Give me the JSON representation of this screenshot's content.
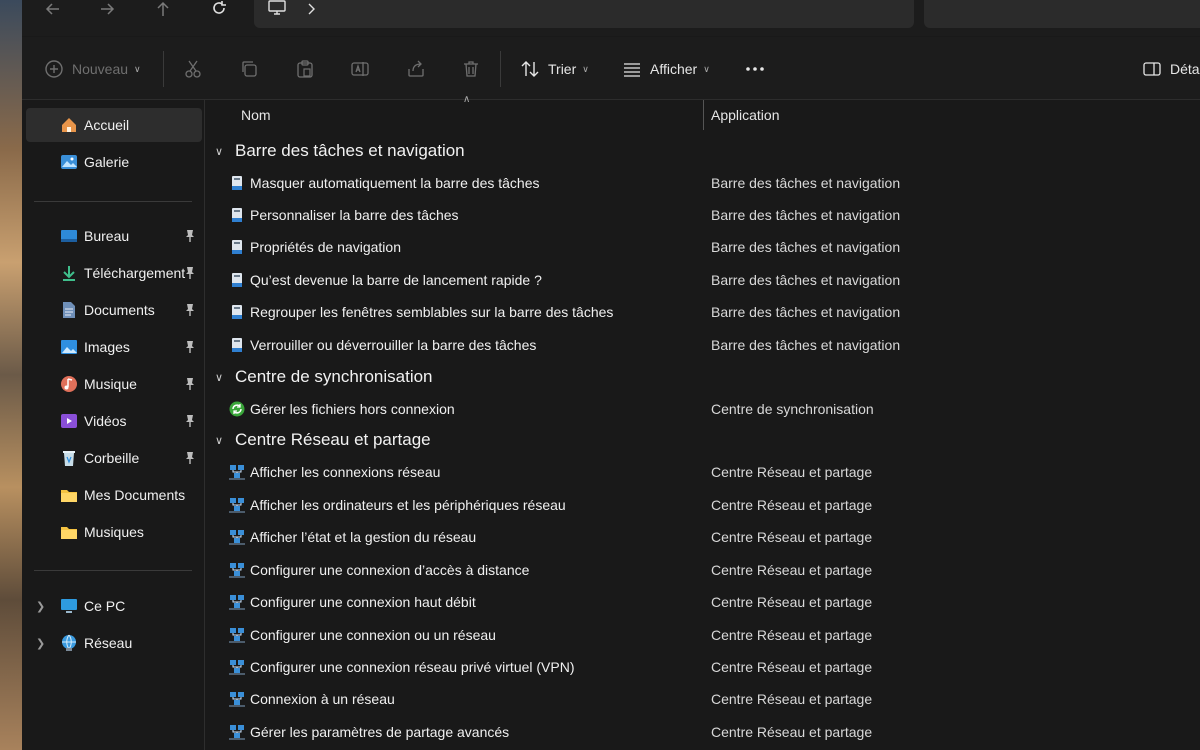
{
  "toolbar": {
    "new_label": "Nouveau",
    "sort_label": "Trier",
    "view_label": "Afficher",
    "details_label": "Déta"
  },
  "sidebar": {
    "home": "Accueil",
    "gallery": "Galerie",
    "quick": [
      {
        "label": "Bureau",
        "icon": "desktop-icon"
      },
      {
        "label": "Téléchargement",
        "icon": "download-icon"
      },
      {
        "label": "Documents",
        "icon": "documents-icon"
      },
      {
        "label": "Images",
        "icon": "images-icon"
      },
      {
        "label": "Musique",
        "icon": "music-icon"
      },
      {
        "label": "Vidéos",
        "icon": "videos-icon"
      },
      {
        "label": "Corbeille",
        "icon": "recycle-bin-icon"
      }
    ],
    "folders": [
      {
        "label": "Mes Documents"
      },
      {
        "label": "Musiques"
      }
    ],
    "pc": "Ce PC",
    "network": "Réseau"
  },
  "columns": {
    "name": "Nom",
    "app": "Application"
  },
  "groups": [
    {
      "title": "Barre des tâches et navigation",
      "icon": "taskbar-icon",
      "rows": [
        {
          "name": "Masquer automatiquement la barre des tâches",
          "app": "Barre des tâches et navigation"
        },
        {
          "name": "Personnaliser la barre des tâches",
          "app": "Barre des tâches et navigation"
        },
        {
          "name": "Propriétés de navigation",
          "app": "Barre des tâches et navigation"
        },
        {
          "name": "Qu’est devenue la barre de lancement rapide ?",
          "app": "Barre des tâches et navigation"
        },
        {
          "name": "Regrouper les fenêtres semblables sur la barre des tâches",
          "app": "Barre des tâches et navigation"
        },
        {
          "name": "Verrouiller ou déverrouiller la barre des tâches",
          "app": "Barre des tâches et navigation"
        }
      ]
    },
    {
      "title": "Centre de synchronisation",
      "icon": "sync-icon",
      "rows": [
        {
          "name": "Gérer les fichiers hors connexion",
          "app": "Centre de synchronisation"
        }
      ]
    },
    {
      "title": "Centre Réseau et partage",
      "icon": "network-center-icon",
      "rows": [
        {
          "name": "Afficher les connexions réseau",
          "app": "Centre Réseau et partage"
        },
        {
          "name": "Afficher les ordinateurs et les périphériques réseau",
          "app": "Centre Réseau et partage"
        },
        {
          "name": "Afficher l’état et la gestion du réseau",
          "app": "Centre Réseau et partage"
        },
        {
          "name": "Configurer une connexion d’accès à distance",
          "app": "Centre Réseau et partage"
        },
        {
          "name": "Configurer une connexion haut débit",
          "app": "Centre Réseau et partage"
        },
        {
          "name": "Configurer une connexion ou un réseau",
          "app": "Centre Réseau et partage"
        },
        {
          "name": "Configurer une connexion réseau privé virtuel (VPN)",
          "app": "Centre Réseau et partage"
        },
        {
          "name": "Connexion à un réseau",
          "app": "Centre Réseau et partage"
        },
        {
          "name": "Gérer les paramètres de partage avancés",
          "app": "Centre Réseau et partage"
        }
      ]
    }
  ]
}
